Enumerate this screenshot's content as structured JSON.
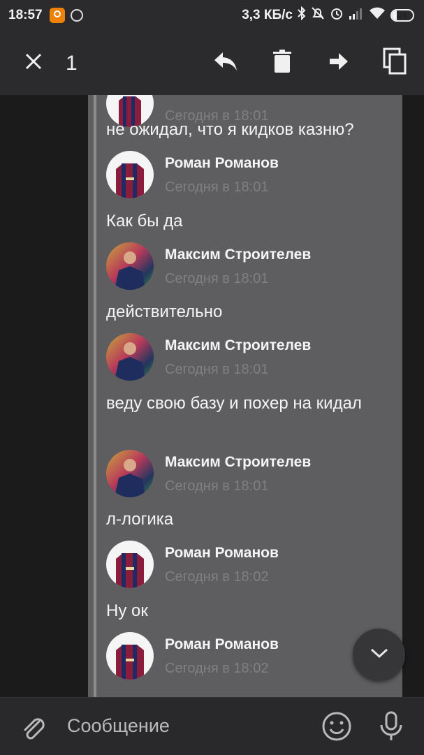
{
  "status_bar": {
    "time": "18:57",
    "net_speed": "3,3 КБ/с",
    "battery_level": "24",
    "battery_fraction": 0.24
  },
  "appbar": {
    "selected_count": "1",
    "icons": [
      "close-icon",
      "reply-icon",
      "delete-icon",
      "forward-icon",
      "copy-icon"
    ]
  },
  "messages": [
    {
      "type": "author",
      "name": "",
      "time": "Сегодня в 18:01"
    },
    {
      "type": "text",
      "text": "не ожидал, что я кидков казню?"
    },
    {
      "type": "author",
      "name": "Роман Романов",
      "time": "Сегодня в 18:01"
    },
    {
      "type": "text",
      "text": "Как бы да"
    },
    {
      "type": "author",
      "name": "Максим Строителев",
      "time": "Сегодня в 18:01"
    },
    {
      "type": "text",
      "text": "действительно"
    },
    {
      "type": "author",
      "name": "Максим Строителев",
      "time": "Сегодня в 18:01"
    },
    {
      "type": "text",
      "text": "веду свою базу и похер на кидал"
    },
    {
      "type": "author",
      "name": "Максим Строителев",
      "time": "Сегодня в 18:01"
    },
    {
      "type": "text",
      "text": "л-логика"
    },
    {
      "type": "author",
      "name": "Роман Романов",
      "time": "Сегодня в 18:02"
    },
    {
      "type": "text",
      "text": "Ну ок"
    },
    {
      "type": "author",
      "name": "Роман Романов",
      "time": "Сегодня в 18:02"
    }
  ],
  "composer": {
    "placeholder": "Сообщение",
    "icons": [
      "attach-icon",
      "emoji-icon",
      "mic-icon"
    ]
  },
  "colors": {
    "selection_bg": "#5e5e60",
    "bar_bg": "#2b2b2d",
    "timestamp": "#808083"
  }
}
